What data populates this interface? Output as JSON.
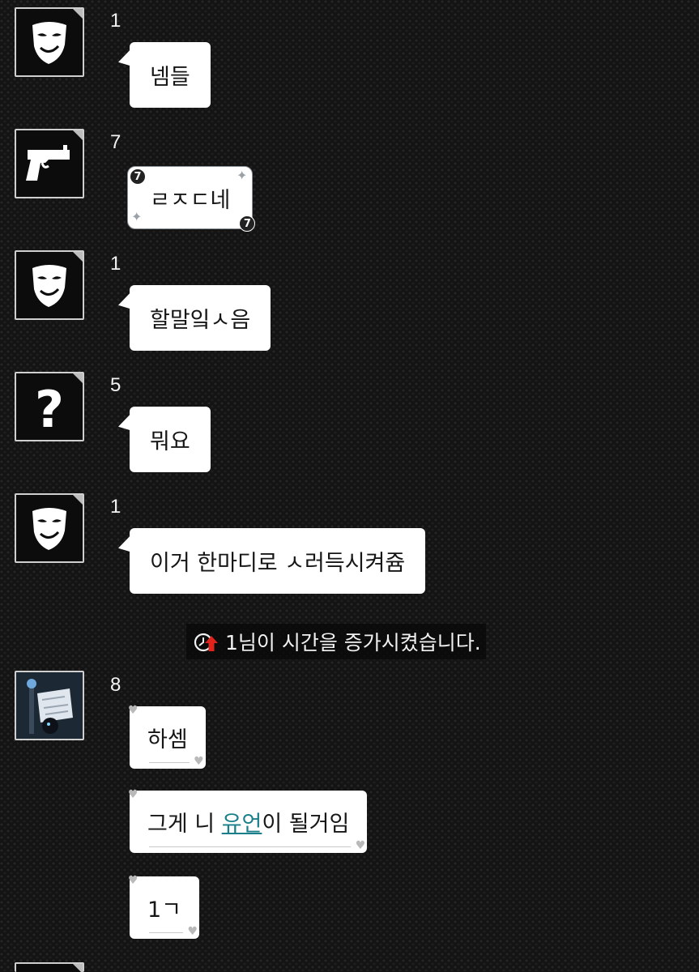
{
  "messages": [
    {
      "sender": "1",
      "text": "넴들",
      "avatar": "mask-icon"
    },
    {
      "sender": "7",
      "text": "ㄹㅈㄷ네",
      "avatar": "gun-icon",
      "badge": "7"
    },
    {
      "sender": "1",
      "text": "할말잌ㅅ음",
      "avatar": "mask-icon"
    },
    {
      "sender": "5",
      "text": "뭐요",
      "avatar": "question-icon"
    },
    {
      "sender": "1",
      "text": "이거 한마디로 ㅅ러득시켜쥼",
      "avatar": "mask-icon"
    },
    {
      "sender": "8",
      "text": "하셈",
      "avatar": "character-icon"
    }
  ],
  "msg7": {
    "before": "그게 니 ",
    "link": "유언",
    "after": "이 될거임"
  },
  "msg8": {
    "text": "1ㄱ"
  },
  "system_message": {
    "text": "1님이 시간을 증가시켰습니다.",
    "icon": "clock-up-icon"
  },
  "colors": {
    "background": "#141414",
    "bubble": "#ffffff",
    "link": "#1a7f8a"
  }
}
